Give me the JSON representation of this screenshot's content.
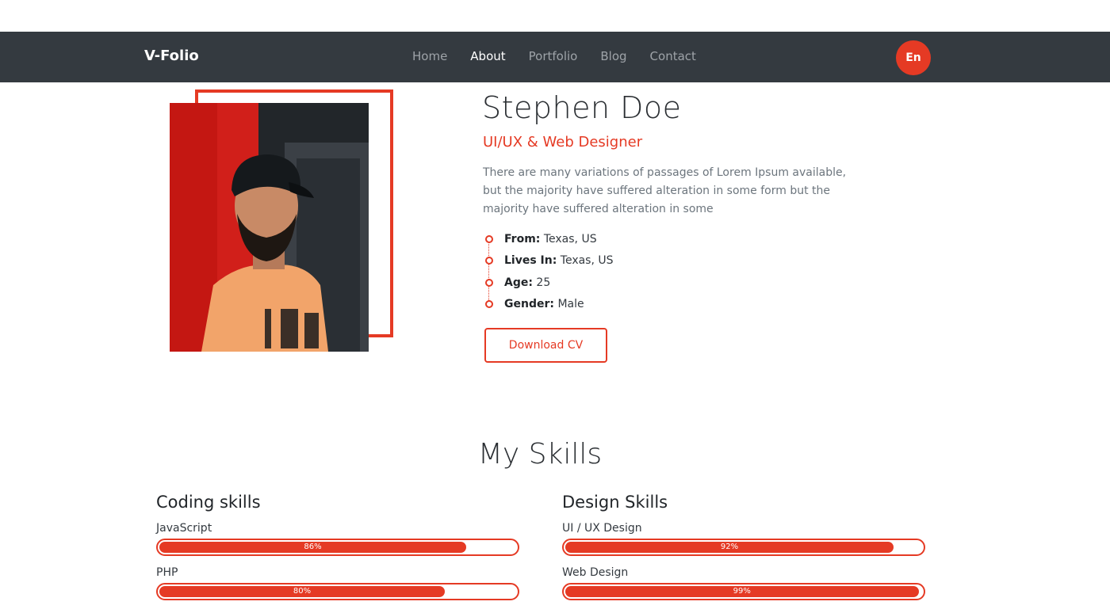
{
  "nav": {
    "brand": "V-Folio",
    "links": [
      {
        "label": "Home",
        "active": false
      },
      {
        "label": "About",
        "active": true
      },
      {
        "label": "Portfolio",
        "active": false
      },
      {
        "label": "Blog",
        "active": false
      },
      {
        "label": "Contact",
        "active": false
      }
    ],
    "lang_button": "En"
  },
  "profile": {
    "name": "Stephen Doe",
    "role": "UI/UX & Web Designer",
    "bio": "There are many variations of passages of Lorem Ipsum available, but the majority have suffered alteration in some form but the majority have suffered alteration in some",
    "details": [
      {
        "label": "From:",
        "value": "Texas, US"
      },
      {
        "label": "Lives In:",
        "value": "Texas, US"
      },
      {
        "label": "Age:",
        "value": "25"
      },
      {
        "label": "Gender:",
        "value": "Male"
      }
    ],
    "cv_button": "Download CV"
  },
  "skills": {
    "title": "My Skills",
    "coding": {
      "heading": "Coding skills",
      "items": [
        {
          "name": "JavaScript",
          "percent": 86,
          "label": "86%"
        },
        {
          "name": "PHP",
          "percent": 80,
          "label": "80%"
        }
      ]
    },
    "design": {
      "heading": "Design Skills",
      "items": [
        {
          "name": "UI / UX Design",
          "percent": 92,
          "label": "92%"
        },
        {
          "name": "Web Design",
          "percent": 99,
          "label": "99%"
        }
      ]
    }
  },
  "colors": {
    "accent": "#e53a24",
    "navbar": "#343a40"
  },
  "icons": {
    "detail_bullet": "circle-outline-icon"
  }
}
